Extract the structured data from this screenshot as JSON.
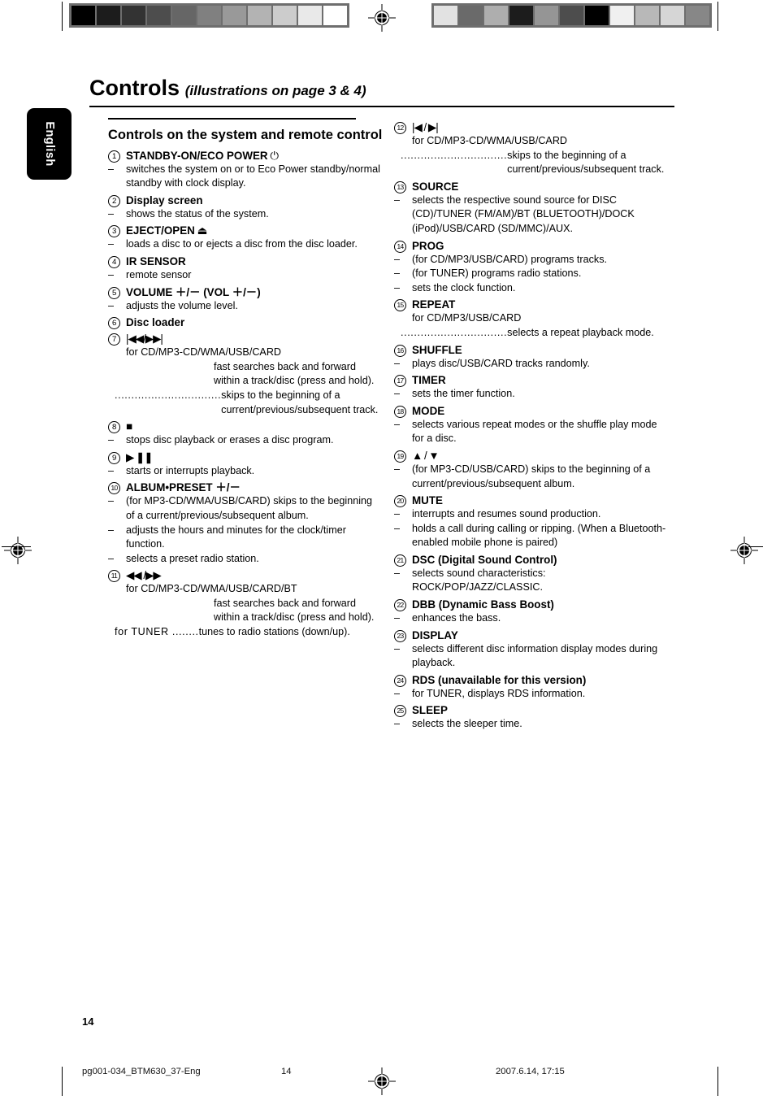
{
  "language_tab": {
    "label": "English"
  },
  "header": {
    "title_main": "Controls",
    "title_sub": "(illustrations on page 3 & 4)"
  },
  "section": {
    "heading": "Controls on the system and remote control"
  },
  "footer": {
    "page_number": "14",
    "file_name": "pg001-034_BTM630_37-Eng",
    "footer_page": "14",
    "timestamp": "2007.6.14, 17:15"
  },
  "calibration": {
    "left_strip": [
      "#000000",
      "#1c1c1c",
      "#333333",
      "#4d4d4d",
      "#666666",
      "#808080",
      "#999999",
      "#b3b3b3",
      "#cccccc",
      "#e9e9e9",
      "#ffffff"
    ],
    "right_strip": [
      "#e2e2e2",
      "#6a6a6a",
      "#aeaeae",
      "#1c1c1c",
      "#959595",
      "#4d4d4d",
      "#000000",
      "#f0f0f0",
      "#b8b8b8",
      "#d6d6d6",
      "#878787"
    ]
  },
  "columns": {
    "left": [
      {
        "num": "1",
        "label": "STANDBY-ON/ECO POWER",
        "glyph": "⏻",
        "lines": [
          {
            "type": "dash",
            "text": "switches the system on or to Eco Power standby/normal standby with clock display."
          }
        ]
      },
      {
        "num": "2",
        "label": "Display screen",
        "glyph": "",
        "lines": [
          {
            "type": "dash",
            "text": "shows the status of the system."
          }
        ]
      },
      {
        "num": "3",
        "label": "EJECT/OPEN",
        "glyph": "⏏",
        "lines": [
          {
            "type": "dash",
            "text": "loads a disc to or ejects a disc from the disc loader."
          }
        ]
      },
      {
        "num": "4",
        "label": "IR SENSOR",
        "glyph": "",
        "lines": [
          {
            "type": "dash",
            "text": "remote sensor"
          }
        ]
      },
      {
        "num": "5",
        "label": "VOLUME ＋/－  (VOL ＋/－)",
        "glyph": "",
        "lines": [
          {
            "type": "dash",
            "text": "adjusts the volume level."
          }
        ]
      },
      {
        "num": "6",
        "label": "Disc loader",
        "glyph": "",
        "lines": []
      },
      {
        "num": "7",
        "label": "",
        "glyph": "|◀◀/▶▶|",
        "lines": [
          {
            "type": "plain",
            "text": "for CD/MP3-CD/WMA/USB/CARD"
          },
          {
            "type": "deep",
            "text": "fast searches back and forward within a track/disc (press and hold)."
          },
          {
            "type": "leader",
            "leader": "................................",
            "text": "skips to the beginning of a current/previous/subsequent track."
          }
        ]
      },
      {
        "num": "8",
        "label": "",
        "glyph": "■",
        "lines": [
          {
            "type": "dash",
            "text": "stops disc playback or erases a disc program."
          }
        ]
      },
      {
        "num": "9",
        "label": "",
        "glyph": "▶ ❚❚",
        "lines": [
          {
            "type": "dash",
            "text": "starts or interrupts playback."
          }
        ]
      },
      {
        "num": "10",
        "label": "ALBUM•PRESET ＋/－",
        "glyph": "",
        "lines": [
          {
            "type": "dash",
            "text": "(for MP3-CD/WMA/USB/CARD) skips to the beginning of a current/previous/subsequent album."
          },
          {
            "type": "dash",
            "text": "adjusts the hours and minutes for the clock/timer function."
          },
          {
            "type": "dash",
            "text": "selects a preset radio station."
          }
        ]
      },
      {
        "num": "11",
        "label": "",
        "glyph": "◀◀ /▶▶",
        "lines": [
          {
            "type": "plain",
            "text": "for CD/MP3-CD/WMA/USB/CARD/BT"
          },
          {
            "type": "deep",
            "text": "fast searches back and forward within a track/disc (press and hold)."
          },
          {
            "type": "leader",
            "leader": "for TUNER ........",
            "text": "tunes to radio stations (down/up)."
          }
        ]
      }
    ],
    "right": [
      {
        "num": "12",
        "label": "",
        "glyph": "|◀ / ▶|",
        "lines": [
          {
            "type": "plain",
            "text": "for CD/MP3-CD/WMA/USB/CARD"
          },
          {
            "type": "leader",
            "leader": "................................",
            "text": "skips to the beginning of a current/previous/subsequent track."
          }
        ]
      },
      {
        "num": "13",
        "label": "SOURCE",
        "glyph": "",
        "lines": [
          {
            "type": "dash",
            "text": "selects the respective sound source for DISC (CD)/TUNER (FM/AM)/BT (BLUETOOTH)/DOCK (iPod)/USB/CARD (SD/MMC)/AUX."
          }
        ]
      },
      {
        "num": "14",
        "label": "PROG",
        "glyph": "",
        "lines": [
          {
            "type": "dash",
            "text": "(for CD/MP3/USB/CARD) programs tracks."
          },
          {
            "type": "dash",
            "text": "(for TUNER) programs radio stations."
          },
          {
            "type": "dash",
            "text": "sets the clock function."
          }
        ]
      },
      {
        "num": "15",
        "label": "REPEAT",
        "glyph": "",
        "lines": [
          {
            "type": "plain",
            "text": "for CD/MP3/USB/CARD"
          },
          {
            "type": "leader",
            "leader": "................................",
            "text": "selects a repeat playback mode."
          }
        ]
      },
      {
        "num": "16",
        "label": "SHUFFLE",
        "glyph": "",
        "lines": [
          {
            "type": "dash",
            "text": "plays disc/USB/CARD tracks randomly."
          }
        ]
      },
      {
        "num": "17",
        "label": "TIMER",
        "glyph": "",
        "lines": [
          {
            "type": "dash",
            "text": "sets the timer function."
          }
        ]
      },
      {
        "num": "18",
        "label": "MODE",
        "glyph": "",
        "lines": [
          {
            "type": "dash",
            "text": "selects various repeat modes or the shuffle play mode for a disc."
          }
        ]
      },
      {
        "num": "19",
        "label": "",
        "glyph": "▲ / ▼",
        "lines": [
          {
            "type": "dash",
            "text": "(for MP3-CD/USB/CARD) skips to the beginning of a current/previous/subsequent album."
          }
        ]
      },
      {
        "num": "20",
        "label": "MUTE",
        "glyph": "",
        "lines": [
          {
            "type": "dash",
            "text": "interrupts and resumes sound production."
          },
          {
            "type": "dash",
            "text": "holds a call during calling or ripping. (When a Bluetooth-enabled mobile phone is paired)"
          }
        ]
      },
      {
        "num": "21",
        "label": "DSC (Digital Sound Control)",
        "glyph": "",
        "lines": [
          {
            "type": "dash",
            "text": "selects sound characteristics: ROCK/POP/JAZZ/CLASSIC."
          }
        ]
      },
      {
        "num": "22",
        "label": "DBB (Dynamic Bass Boost)",
        "glyph": "",
        "lines": [
          {
            "type": "dash",
            "text": "enhances the bass."
          }
        ]
      },
      {
        "num": "23",
        "label": "DISPLAY",
        "glyph": "",
        "lines": [
          {
            "type": "dash",
            "text": "selects different disc information display modes during playback."
          }
        ]
      },
      {
        "num": "24",
        "label": "RDS (unavailable for this version)",
        "glyph": "",
        "lines": [
          {
            "type": "dash",
            "text": "for TUNER, displays RDS information."
          }
        ]
      },
      {
        "num": "25",
        "label": "SLEEP",
        "glyph": "",
        "lines": [
          {
            "type": "dash",
            "text": "selects the sleeper time."
          }
        ]
      }
    ]
  }
}
